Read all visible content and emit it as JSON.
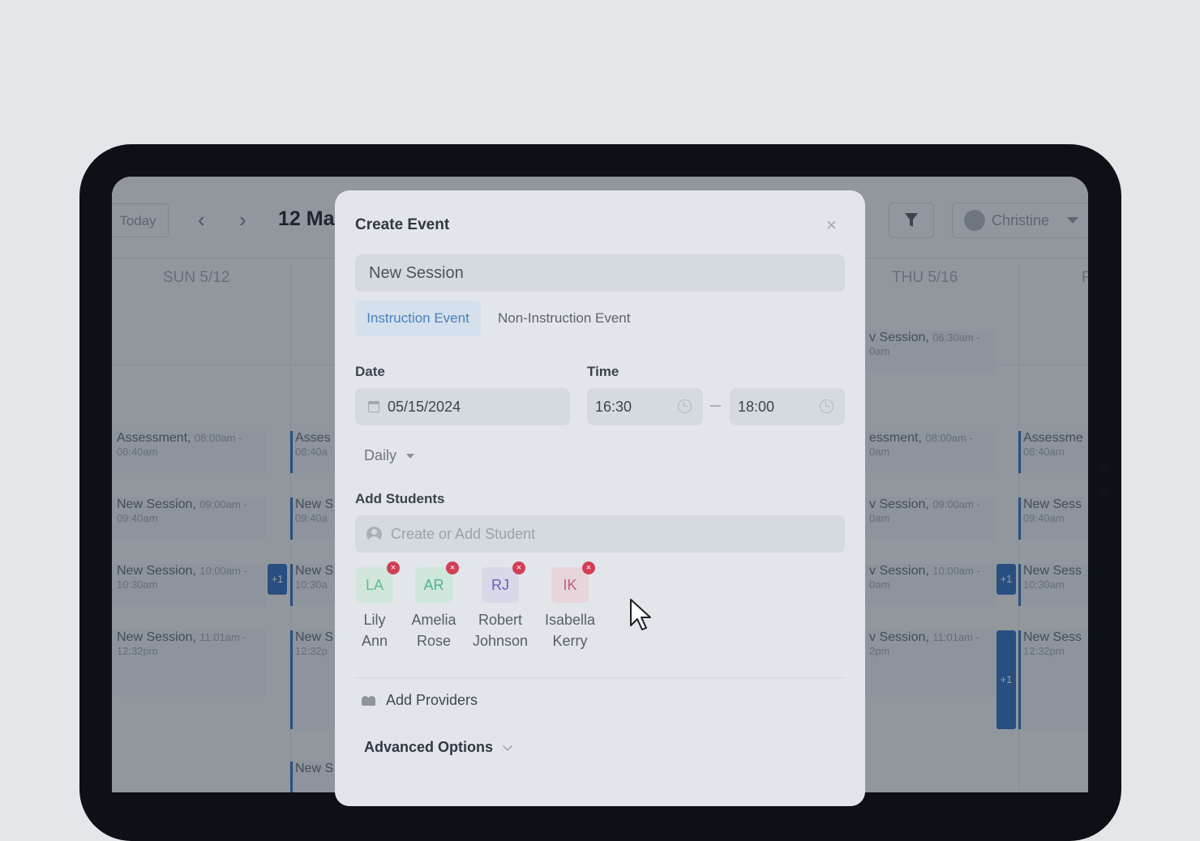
{
  "calendar": {
    "today_label": "Today",
    "prev_label": "‹",
    "next_label": "›",
    "title": "12 Ma",
    "user_name": "Christine",
    "days": [
      "SUN 5/12",
      "THU 5/16",
      "F"
    ],
    "events_left": [
      {
        "title": "Assessment,",
        "time_a": "08:00am -",
        "time_b": "08:40am"
      },
      {
        "title": "New Session,",
        "time_a": "09:00am -",
        "time_b": "09:40am"
      },
      {
        "title": "New Session,",
        "time_a": "10:00am -",
        "time_b": "10:30am"
      },
      {
        "title": "New Session,",
        "time_a": "11:01am -",
        "time_b": "12:32pm"
      }
    ],
    "events_col2": [
      {
        "title": "Asses",
        "time": "08:40a"
      },
      {
        "title": "New S",
        "time": "09:40a"
      },
      {
        "title": "New S",
        "time": "10:30a"
      },
      {
        "title": "New S",
        "time": "12:32p"
      },
      {
        "title": "New S",
        "time": ""
      }
    ],
    "events_thu": [
      {
        "title": "v Session,",
        "time_a": "06:30am -",
        "time_b": "0am"
      },
      {
        "title": "essment,",
        "time_a": "08:00am -",
        "time_b": "0am"
      },
      {
        "title": "v Session,",
        "time_a": "09:00am -",
        "time_b": "0am"
      },
      {
        "title": "v Session,",
        "time_a": "10:00am -",
        "time_b": "0am"
      },
      {
        "title": "v Session,",
        "time_a": "11:01am -",
        "time_b": "2pm"
      }
    ],
    "events_fri": [
      {
        "title": "Assessme",
        "time": "08:40am"
      },
      {
        "title": "New Sess",
        "time": "09:40am"
      },
      {
        "title": "New Sess",
        "time": "10:30am"
      },
      {
        "title": "New Sess",
        "time": "12:32pm"
      }
    ],
    "plus_label": "+1"
  },
  "modal": {
    "title": "Create Event",
    "close_label": "×",
    "event_name": "New Session",
    "tabs": [
      {
        "label": "Instruction Event",
        "active": true
      },
      {
        "label": "Non-Instruction Event",
        "active": false
      }
    ],
    "date_label": "Date",
    "date_value": "05/15/2024",
    "time_label": "Time",
    "time_start": "16:30",
    "time_end": "18:00",
    "recurrence": "Daily",
    "students_label": "Add Students",
    "students_placeholder": "Create or Add Student",
    "students": [
      {
        "initials": "LA",
        "first": "Lily",
        "last": "Ann",
        "color": "#5fbf8a",
        "bg": "#d2e6dc"
      },
      {
        "initials": "AR",
        "first": "Amelia",
        "last": "Rose",
        "color": "#4ab38a",
        "bg": "#d0e5dc"
      },
      {
        "initials": "RJ",
        "first": "Robert",
        "last": "Johnson",
        "color": "#6b5fc0",
        "bg": "#d8d8e8"
      },
      {
        "initials": "IK",
        "first": "Isabella",
        "last": "Kerry",
        "color": "#c45a78",
        "bg": "#e6d6dc"
      }
    ],
    "remove_label": "×",
    "providers_label": "Add Providers",
    "advanced_label": "Advanced Options"
  }
}
